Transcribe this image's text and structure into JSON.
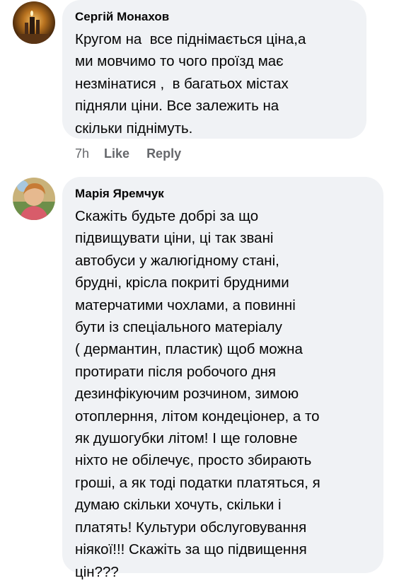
{
  "comments": [
    {
      "author": "Сергій Монахов",
      "text": "Кругом на  все піднімається ціна,а\nми мовчимо то чого проїзд має\nнезмінатися ,  в багатьох містах\nпідняли ціни. Все залежить на\nскільки піднімуть.",
      "time": "7h",
      "like_label": "Like",
      "reply_label": "Reply"
    },
    {
      "author": "Марія Яремчук",
      "text": "Скажіть будьте добрі за що\nпідвищувати ціни, ці так звані\nавтобуси у жалюгідному стані,\nбрудні, крісла покриті брудними\nматерчатими чохлами, а повинні\nбути із спеціального матеріалу\n( дермантин, пластик) щоб можна\nпротирати після робочого дня\nдезинфікуючим розчином, зимою\nотоплерння, літом кондеціонер, а то\nяк душогубки літом! І ще головне\nніхто не обілечує, просто збирають\nгроші, а як тоді податки платяться, я\nдумаю скільки хочуть, скільки і\nплатять! Культури обслуговування\nніякої!!! Скажіть за що підвищення\nцін???"
    }
  ],
  "colors": {
    "bubble_bg": "#f0f2f5",
    "text": "#050505",
    "secondary_text": "#65676b"
  }
}
